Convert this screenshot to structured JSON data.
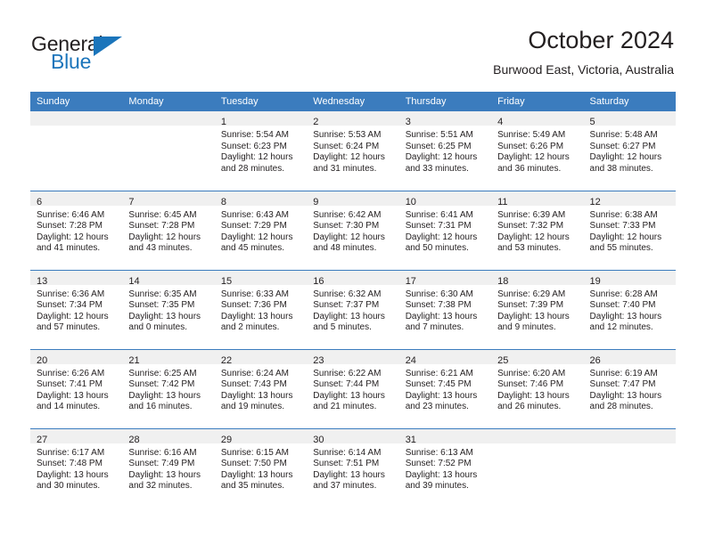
{
  "brand": {
    "name_top": "General",
    "name_bottom": "Blue",
    "accent_color": "#1b75bb"
  },
  "header": {
    "title": "October 2024",
    "location": "Burwood East, Victoria, Australia"
  },
  "theme": {
    "header_blue": "#3b7cbe",
    "daynum_band": "#f0f0f0",
    "text": "#231f20"
  },
  "weekdays": [
    "Sunday",
    "Monday",
    "Tuesday",
    "Wednesday",
    "Thursday",
    "Friday",
    "Saturday"
  ],
  "weeks": [
    [
      {
        "day": "",
        "lines": []
      },
      {
        "day": "",
        "lines": []
      },
      {
        "day": "1",
        "lines": [
          "Sunrise: 5:54 AM",
          "Sunset: 6:23 PM",
          "Daylight: 12 hours",
          "and 28 minutes."
        ]
      },
      {
        "day": "2",
        "lines": [
          "Sunrise: 5:53 AM",
          "Sunset: 6:24 PM",
          "Daylight: 12 hours",
          "and 31 minutes."
        ]
      },
      {
        "day": "3",
        "lines": [
          "Sunrise: 5:51 AM",
          "Sunset: 6:25 PM",
          "Daylight: 12 hours",
          "and 33 minutes."
        ]
      },
      {
        "day": "4",
        "lines": [
          "Sunrise: 5:49 AM",
          "Sunset: 6:26 PM",
          "Daylight: 12 hours",
          "and 36 minutes."
        ]
      },
      {
        "day": "5",
        "lines": [
          "Sunrise: 5:48 AM",
          "Sunset: 6:27 PM",
          "Daylight: 12 hours",
          "and 38 minutes."
        ]
      }
    ],
    [
      {
        "day": "6",
        "lines": [
          "Sunrise: 6:46 AM",
          "Sunset: 7:28 PM",
          "Daylight: 12 hours",
          "and 41 minutes."
        ]
      },
      {
        "day": "7",
        "lines": [
          "Sunrise: 6:45 AM",
          "Sunset: 7:28 PM",
          "Daylight: 12 hours",
          "and 43 minutes."
        ]
      },
      {
        "day": "8",
        "lines": [
          "Sunrise: 6:43 AM",
          "Sunset: 7:29 PM",
          "Daylight: 12 hours",
          "and 45 minutes."
        ]
      },
      {
        "day": "9",
        "lines": [
          "Sunrise: 6:42 AM",
          "Sunset: 7:30 PM",
          "Daylight: 12 hours",
          "and 48 minutes."
        ]
      },
      {
        "day": "10",
        "lines": [
          "Sunrise: 6:41 AM",
          "Sunset: 7:31 PM",
          "Daylight: 12 hours",
          "and 50 minutes."
        ]
      },
      {
        "day": "11",
        "lines": [
          "Sunrise: 6:39 AM",
          "Sunset: 7:32 PM",
          "Daylight: 12 hours",
          "and 53 minutes."
        ]
      },
      {
        "day": "12",
        "lines": [
          "Sunrise: 6:38 AM",
          "Sunset: 7:33 PM",
          "Daylight: 12 hours",
          "and 55 minutes."
        ]
      }
    ],
    [
      {
        "day": "13",
        "lines": [
          "Sunrise: 6:36 AM",
          "Sunset: 7:34 PM",
          "Daylight: 12 hours",
          "and 57 minutes."
        ]
      },
      {
        "day": "14",
        "lines": [
          "Sunrise: 6:35 AM",
          "Sunset: 7:35 PM",
          "Daylight: 13 hours",
          "and 0 minutes."
        ]
      },
      {
        "day": "15",
        "lines": [
          "Sunrise: 6:33 AM",
          "Sunset: 7:36 PM",
          "Daylight: 13 hours",
          "and 2 minutes."
        ]
      },
      {
        "day": "16",
        "lines": [
          "Sunrise: 6:32 AM",
          "Sunset: 7:37 PM",
          "Daylight: 13 hours",
          "and 5 minutes."
        ]
      },
      {
        "day": "17",
        "lines": [
          "Sunrise: 6:30 AM",
          "Sunset: 7:38 PM",
          "Daylight: 13 hours",
          "and 7 minutes."
        ]
      },
      {
        "day": "18",
        "lines": [
          "Sunrise: 6:29 AM",
          "Sunset: 7:39 PM",
          "Daylight: 13 hours",
          "and 9 minutes."
        ]
      },
      {
        "day": "19",
        "lines": [
          "Sunrise: 6:28 AM",
          "Sunset: 7:40 PM",
          "Daylight: 13 hours",
          "and 12 minutes."
        ]
      }
    ],
    [
      {
        "day": "20",
        "lines": [
          "Sunrise: 6:26 AM",
          "Sunset: 7:41 PM",
          "Daylight: 13 hours",
          "and 14 minutes."
        ]
      },
      {
        "day": "21",
        "lines": [
          "Sunrise: 6:25 AM",
          "Sunset: 7:42 PM",
          "Daylight: 13 hours",
          "and 16 minutes."
        ]
      },
      {
        "day": "22",
        "lines": [
          "Sunrise: 6:24 AM",
          "Sunset: 7:43 PM",
          "Daylight: 13 hours",
          "and 19 minutes."
        ]
      },
      {
        "day": "23",
        "lines": [
          "Sunrise: 6:22 AM",
          "Sunset: 7:44 PM",
          "Daylight: 13 hours",
          "and 21 minutes."
        ]
      },
      {
        "day": "24",
        "lines": [
          "Sunrise: 6:21 AM",
          "Sunset: 7:45 PM",
          "Daylight: 13 hours",
          "and 23 minutes."
        ]
      },
      {
        "day": "25",
        "lines": [
          "Sunrise: 6:20 AM",
          "Sunset: 7:46 PM",
          "Daylight: 13 hours",
          "and 26 minutes."
        ]
      },
      {
        "day": "26",
        "lines": [
          "Sunrise: 6:19 AM",
          "Sunset: 7:47 PM",
          "Daylight: 13 hours",
          "and 28 minutes."
        ]
      }
    ],
    [
      {
        "day": "27",
        "lines": [
          "Sunrise: 6:17 AM",
          "Sunset: 7:48 PM",
          "Daylight: 13 hours",
          "and 30 minutes."
        ]
      },
      {
        "day": "28",
        "lines": [
          "Sunrise: 6:16 AM",
          "Sunset: 7:49 PM",
          "Daylight: 13 hours",
          "and 32 minutes."
        ]
      },
      {
        "day": "29",
        "lines": [
          "Sunrise: 6:15 AM",
          "Sunset: 7:50 PM",
          "Daylight: 13 hours",
          "and 35 minutes."
        ]
      },
      {
        "day": "30",
        "lines": [
          "Sunrise: 6:14 AM",
          "Sunset: 7:51 PM",
          "Daylight: 13 hours",
          "and 37 minutes."
        ]
      },
      {
        "day": "31",
        "lines": [
          "Sunrise: 6:13 AM",
          "Sunset: 7:52 PM",
          "Daylight: 13 hours",
          "and 39 minutes."
        ]
      },
      {
        "day": "",
        "lines": []
      },
      {
        "day": "",
        "lines": []
      }
    ]
  ]
}
